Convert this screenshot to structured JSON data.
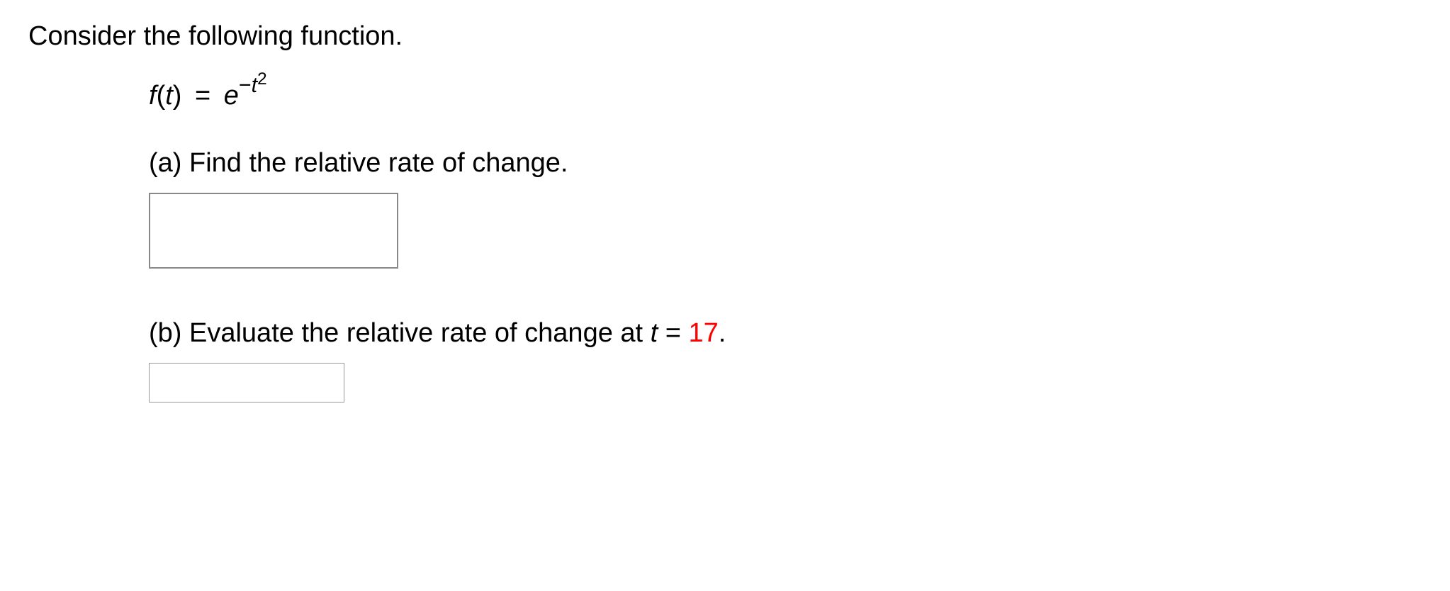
{
  "intro": "Consider the following function.",
  "equation": {
    "f_open": "f",
    "paren_open": "(",
    "var": "t",
    "paren_close": ")",
    "equals": " = ",
    "base": "e",
    "exp_minus": "−",
    "exp_var": "t",
    "exp_pow": "2"
  },
  "part_a": {
    "label": "(a) Find the relative rate of change.",
    "input_value": ""
  },
  "part_b": {
    "prefix": "(b) Evaluate the relative rate of change at  ",
    "var": "t",
    "equals": " = ",
    "value": "17",
    "period": ".",
    "input_value": ""
  }
}
